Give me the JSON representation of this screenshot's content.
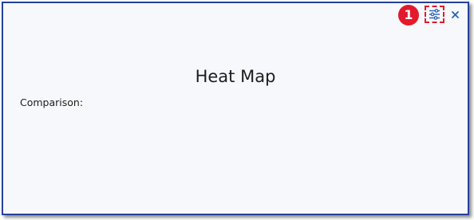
{
  "header": {
    "step_number": "1",
    "settings_icon": "sliders-icon",
    "close_icon": "close-icon",
    "accent_color": "#2a62b8",
    "highlight_color": "#e3192c",
    "border_color": "#25419b"
  },
  "panel": {
    "title": "Heat Map",
    "comparison_label": "Comparison:"
  }
}
